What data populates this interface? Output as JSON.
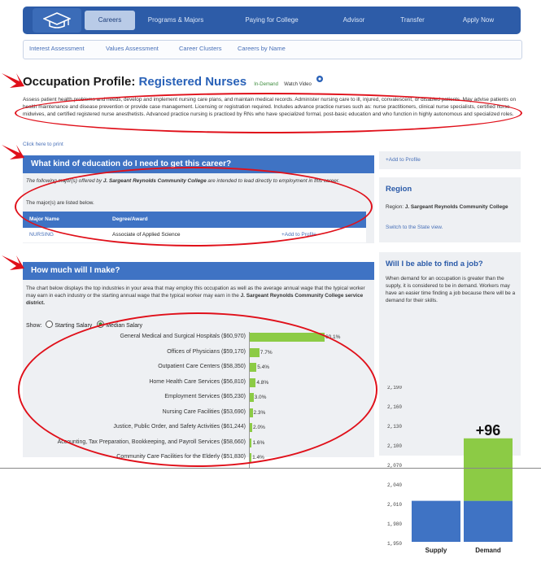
{
  "nav": {
    "tabs": [
      "Careers",
      "Programs & Majors",
      "Paying for College",
      "Advisor",
      "Transfer",
      "Apply Now"
    ],
    "active": "Careers"
  },
  "subnav": [
    "Interest Assessment",
    "Values Assessment",
    "Career Clusters",
    "Careers by Name"
  ],
  "profile": {
    "prefix": "Occupation Profile:",
    "occupation": "Registered Nurses",
    "in_demand": "In-Demand",
    "watch_video": "Watch Video",
    "description": "Assess patient health problems and needs, develop and implement nursing care plans, and maintain medical records. Administer nursing care to ill, injured, convalescent, or disabled patients. May advise patients on health maintenance and disease prevention or provide case management. Licensing or registration required. Includes advance practice nurses such as: nurse practitioners, clinical nurse specialists, certified nurse midwives, and certified registered nurse anesthetists. Advanced practice nursing is practiced by RNs who have specialized formal, post-basic education and who function in highly autonomous and specialized roles.",
    "print_link": "Click here to print"
  },
  "education": {
    "heading": "What kind of education do I need to get this career?",
    "intro_pre": "The following major(s) offered by",
    "college": "J. Sargeant Reynolds Community College",
    "intro_post": "are intended to lead directly to employment in this career.",
    "listed": "The major(s) are listed below.",
    "columns": [
      "Major Name",
      "Degree/Award"
    ],
    "rows": [
      {
        "major": "NURSING",
        "degree": "Associate of Applied Science",
        "action": "+Add to Profile"
      }
    ]
  },
  "salary": {
    "heading": "How much will I make?",
    "text_pre": "The chart below displays the top industries in your area that may employ this occupation as well as the average annual wage that the typical worker may earn in each industry or the starting annual wage that the typical worker may earn in the",
    "district": "J. Sargeant Reynolds Community College service district.",
    "show_label": "Show:",
    "options": [
      "Starting Salary",
      "Median Salary"
    ],
    "selected": "Median Salary"
  },
  "chart_data": [
    {
      "type": "bar",
      "orientation": "horizontal",
      "categories": [
        "General Medical and Surgical Hospitals ($60,970)",
        "Offices of Physicians ($59,170)",
        "Outpatient Care Centers ($58,350)",
        "Home Health Care Services ($56,810)",
        "Employment Services ($65,230)",
        "Nursing Care Facilities ($53,690)",
        "Justice, Public Order, and Safety Activities ($61,244)",
        "Accounting, Tax Preparation, Bookkeeping, and Payroll Services ($58,660)",
        "Community Care Facilities for the Elderly ($51,830)"
      ],
      "values": [
        60.1,
        7.7,
        5.4,
        4.8,
        3.0,
        2.3,
        2.0,
        1.6,
        1.4
      ],
      "value_labels": [
        "60.1%",
        "7.7%",
        "5.4%",
        "4.8%",
        "3.0%",
        "2.3%",
        "2.0%",
        "1.6%",
        "1.4%"
      ],
      "color": "#8ccb45"
    },
    {
      "type": "bar",
      "categories": [
        "Supply",
        "Demand"
      ],
      "series": [
        {
          "values": [
            2013,
            2013
          ],
          "color": "#3f73c4"
        },
        {
          "values": [
            0,
            96
          ],
          "color": "#8ccb45"
        }
      ],
      "ylim": [
        1950,
        2190
      ],
      "yticks": [
        "2,190",
        "2,160",
        "2,130",
        "2,100",
        "2,070",
        "2,040",
        "2,010",
        "1,980",
        "1,950"
      ],
      "annotation": "+96"
    }
  ],
  "sidebar": {
    "add_profile": "+Add to Profile",
    "region_heading": "Region",
    "region_label": "Region:",
    "region_name": "J. Sargeant Reynolds Community College",
    "switch_link": "Switch to the State view.",
    "job_heading": "Will I be able to find a job?",
    "job_text": "When demand for an occupation is greater than the supply, it is considered to be in demand. Workers may have an easier time finding a job because there will be a demand for their skills."
  },
  "colors": {
    "nav": "#2d5ca8",
    "header": "#3f73c4",
    "bar_green": "#8ccb45",
    "annotation": "#e0101a"
  }
}
